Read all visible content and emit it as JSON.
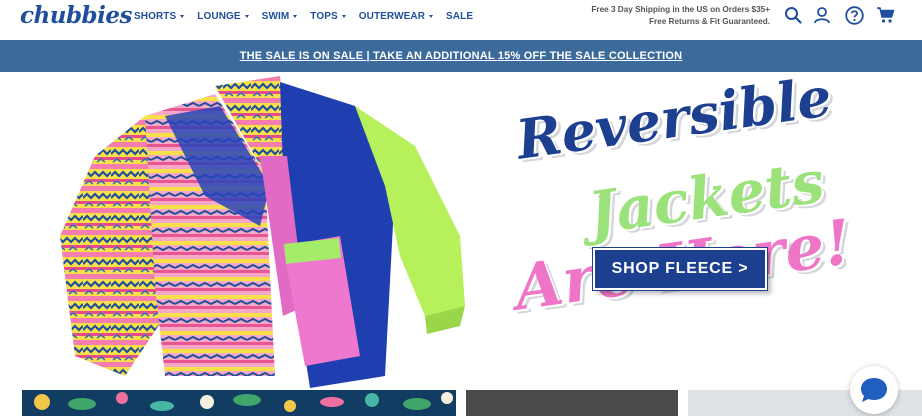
{
  "header": {
    "logo": "chubbies",
    "nav": [
      {
        "label": "SHORTS",
        "dropdown": true
      },
      {
        "label": "LOUNGE",
        "dropdown": true
      },
      {
        "label": "SWIM",
        "dropdown": true
      },
      {
        "label": "TOPS",
        "dropdown": true
      },
      {
        "label": "OUTERWEAR",
        "dropdown": true
      },
      {
        "label": "SALE",
        "dropdown": false
      }
    ],
    "promo_line1": "Free 3 Day Shipping in the US on Orders $35+",
    "promo_line2": "Free Returns & Fit Guaranteed.",
    "icons": [
      "search-icon",
      "account-icon",
      "help-icon",
      "cart-icon"
    ]
  },
  "banner": {
    "text": "THE SALE IS ON SALE | TAKE AN ADDITIONAL 15% OFF THE SALE COLLECTION"
  },
  "hero": {
    "headline_1": "Reversible",
    "headline_2": "Jackets",
    "headline_3": "Are Here!",
    "cta_label": "SHOP FLEECE >"
  },
  "colors": {
    "brand_blue": "#1f4f9c",
    "banner_bg": "#3b6a9b",
    "headline_blue": "#1d3f8f",
    "headline_green": "#9be27a",
    "headline_pink": "#ef76c7"
  }
}
